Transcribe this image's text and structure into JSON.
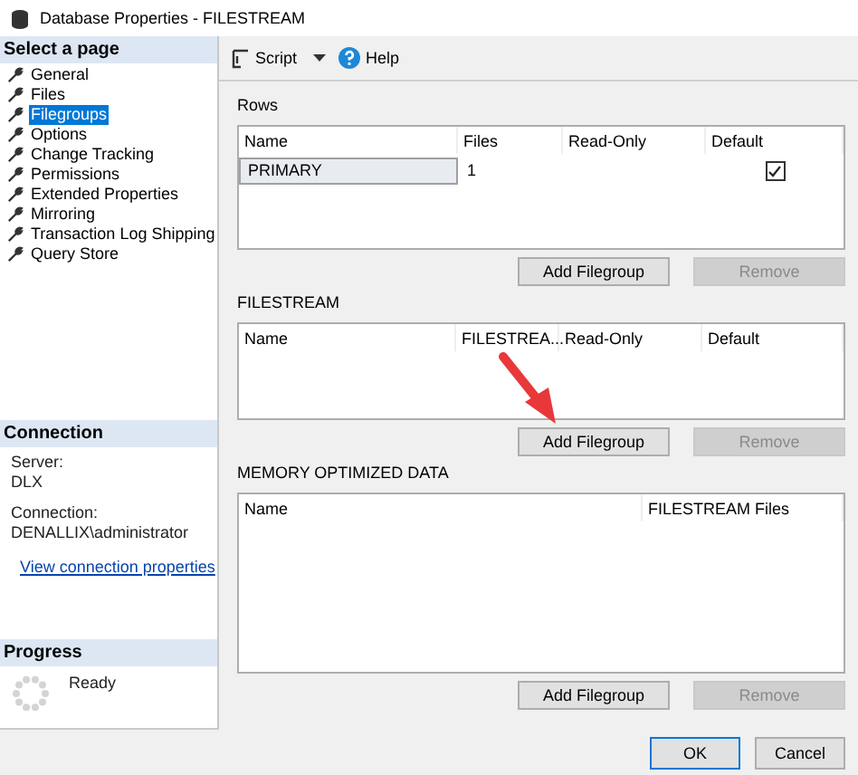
{
  "window": {
    "title": "Database Properties - FILESTREAM"
  },
  "sidebar": {
    "header": "Select a page",
    "items": [
      {
        "label": "General",
        "selected": false
      },
      {
        "label": "Files",
        "selected": false
      },
      {
        "label": "Filegroups",
        "selected": true
      },
      {
        "label": "Options",
        "selected": false
      },
      {
        "label": "Change Tracking",
        "selected": false
      },
      {
        "label": "Permissions",
        "selected": false
      },
      {
        "label": "Extended Properties",
        "selected": false
      },
      {
        "label": "Mirroring",
        "selected": false
      },
      {
        "label": "Transaction Log Shipping",
        "selected": false
      },
      {
        "label": "Query Store",
        "selected": false
      }
    ]
  },
  "connection": {
    "header": "Connection",
    "server_label": "Server:",
    "server": "DLX",
    "connection_label": "Connection:",
    "connection": "DENALLIX\\administrator",
    "link": "View connection properties"
  },
  "progress": {
    "header": "Progress",
    "status": "Ready"
  },
  "toolbar": {
    "script": "Script",
    "help": "Help"
  },
  "sections": [
    {
      "title": "Rows",
      "columns": [
        "Name",
        "Files",
        "Read-Only",
        "Default"
      ],
      "rows": [
        [
          {
            "kind": "text",
            "text": "PRIMARY",
            "selected": true
          },
          {
            "kind": "text",
            "text": "1",
            "selected": false
          },
          {
            "kind": "empty"
          },
          {
            "kind": "checkbox",
            "checked": true
          }
        ]
      ],
      "buttons": [
        {
          "label": "Add Filegroup",
          "disabled": false
        },
        {
          "label": "Remove",
          "disabled": true
        }
      ]
    },
    {
      "title": "FILESTREAM",
      "columns": [
        "Name",
        "FILESTREA...",
        "Read-Only",
        "Default"
      ],
      "buttons": [
        {
          "label": "Add Filegroup",
          "disabled": false
        },
        {
          "label": "Remove",
          "disabled": true
        }
      ]
    },
    {
      "title": "MEMORY OPTIMIZED DATA",
      "columns": [
        "Name",
        "FILESTREAM Files"
      ],
      "buttons": [
        {
          "label": "Add Filegroup",
          "disabled": false
        },
        {
          "label": "Remove",
          "disabled": true
        }
      ]
    }
  ],
  "footer": {
    "buttons": [
      {
        "label": "OK",
        "default": true
      },
      {
        "label": "Cancel",
        "default": false
      }
    ]
  }
}
